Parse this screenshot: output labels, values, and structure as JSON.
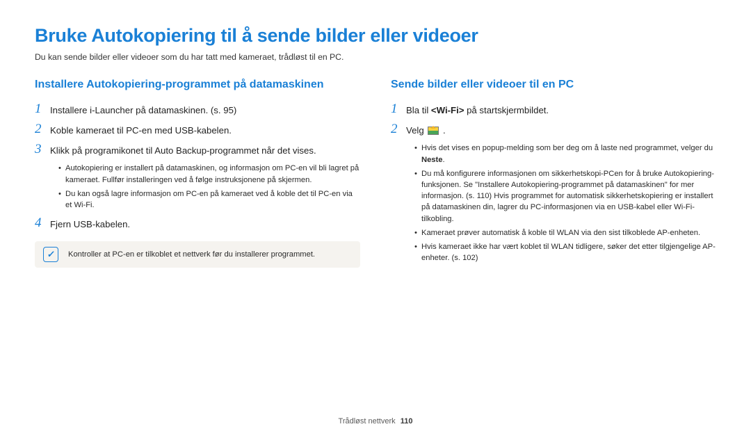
{
  "title": "Bruke Autokopiering til å sende bilder eller videoer",
  "intro": "Du kan sende bilder eller videoer som du har tatt med kameraet, trådløst til en PC.",
  "left": {
    "heading": "Installere Autokopiering-programmet på datamaskinen",
    "step1": "Installere i-Launcher på datamaskinen. (s. 95)",
    "step2": "Koble kameraet til PC-en med USB-kabelen.",
    "step3": "Klikk på programikonet til Auto Backup-programmet når det vises.",
    "bullets3": [
      "Autokopiering er installert på datamaskinen, og informasjon om PC-en vil bli lagret på kameraet. Fullfør installeringen ved å følge instruksjonene på skjermen.",
      "Du kan også lagre informasjon om PC-en på kameraet ved å koble det til PC-en via et Wi-Fi."
    ],
    "step4": "Fjern USB-kabelen.",
    "note": "Kontroller at PC-en er tilkoblet et nettverk før du installerer programmet."
  },
  "right": {
    "heading": "Sende bilder eller videoer til en PC",
    "step1_pre": "Bla til ",
    "step1_bold": "<Wi-Fi>",
    "step1_post": " på startskjermbildet.",
    "step2": "Velg ",
    "bullets2": [
      {
        "pre": "Hvis det vises en popup-melding som ber deg om å laste ned programmet, velger du ",
        "bold": "Neste",
        "post": "."
      },
      {
        "pre": "Du må konfigurere informasjonen om sikkerhetskopi-PCen for å bruke Autokopiering-funksjonen. Se \"Installere Autokopiering-programmet på datamaskinen\" for mer informasjon. (s. 110) Hvis programmet for automatisk sikkerhetskopiering er installert på datamaskinen din, lagrer du PC-informasjonen via en USB-kabel eller Wi-Fi-tilkobling.",
        "bold": "",
        "post": ""
      },
      {
        "pre": "Kameraet prøver automatisk å koble til WLAN via den sist tilkoblede AP-enheten.",
        "bold": "",
        "post": ""
      },
      {
        "pre": "Hvis kameraet ikke har vært koblet til WLAN tidligere, søker det etter tilgjengelige AP-enheter. (s. 102)",
        "bold": "",
        "post": ""
      }
    ]
  },
  "footer": {
    "section": "Trådløst nettverk",
    "page": "110"
  }
}
